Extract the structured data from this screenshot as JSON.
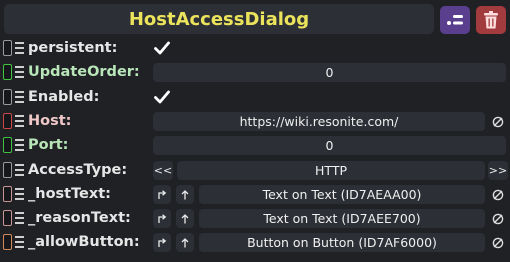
{
  "header": {
    "title": "HostAccessDialog",
    "collapse_icon": "collapse-icon",
    "destroy_icon": "trash-icon",
    "title_color": "#ece35c"
  },
  "fields": {
    "persistent": {
      "label": "persistent:",
      "checked": true,
      "ref_color": "#9a9a9a"
    },
    "update_order": {
      "label": "UpdateOrder:",
      "value": "0",
      "ref_color": "#3fc23f",
      "label_color": "#b9e6b9"
    },
    "enabled": {
      "label": "Enabled:",
      "checked": true,
      "ref_color": "#9a9a9a"
    },
    "host": {
      "label": "Host:",
      "value": "https://wiki.resonite.com/",
      "ref_color": "#c84646",
      "label_color": "#f0c8c8"
    },
    "port": {
      "label": "Port:",
      "value": "0",
      "ref_color": "#3fc23f",
      "label_color": "#b9e6b9"
    },
    "access_type": {
      "label": "AccessType:",
      "value": "HTTP",
      "prev": "<<",
      "next": ">>",
      "ref_color": "#9a9a9a"
    },
    "host_text": {
      "label": "_hostText:",
      "value": "Text on Text (ID7AEAA00)",
      "ref_color": "#c89494"
    },
    "reason_text": {
      "label": "_reasonText:",
      "value": "Text on Text (ID7AEE700)",
      "ref_color": "#c89494"
    },
    "allow_button": {
      "label": "_allowButton:",
      "value": "Button on Button (ID7AF6000)",
      "ref_color": "#d08a5a"
    }
  }
}
